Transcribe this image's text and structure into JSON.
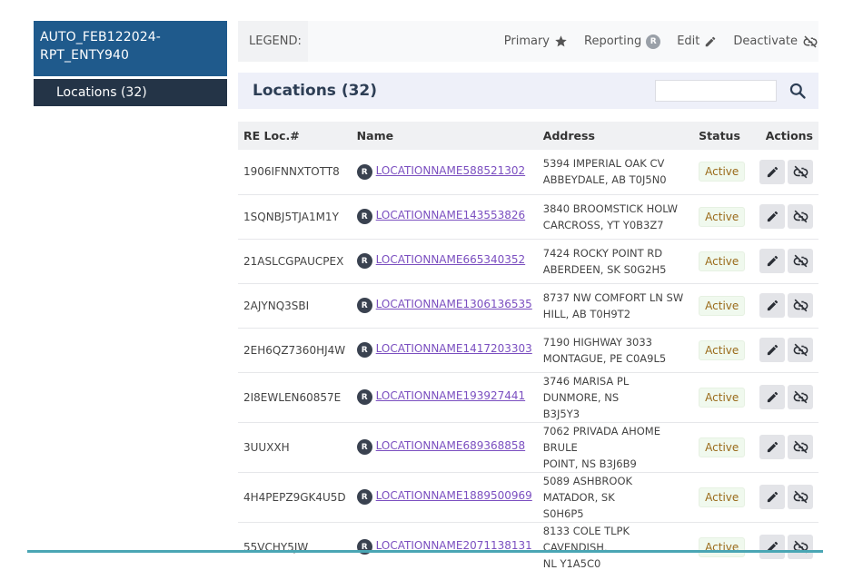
{
  "sidebar": {
    "entity_title": "AUTO_FEB122024-RPT_ENTY940",
    "items": [
      {
        "label": "Locations (32)"
      }
    ]
  },
  "legend": {
    "label": "LEGEND:",
    "items": [
      {
        "label": "Primary",
        "icon": "star-icon"
      },
      {
        "label": "Reporting",
        "icon": "reporting-badge-icon",
        "badge": "R"
      },
      {
        "label": "Edit",
        "icon": "pencil-icon"
      },
      {
        "label": "Deactivate",
        "icon": "unlink-icon"
      }
    ]
  },
  "panel": {
    "title": "Locations (32)",
    "search": {
      "value": "",
      "placeholder": ""
    }
  },
  "table": {
    "columns": [
      "RE Loc.#",
      "Name",
      "Address",
      "Status",
      "Actions"
    ],
    "rows": [
      {
        "loc": "1906IFNNXTOTT8",
        "badge": "R",
        "name": "LOCATIONNAME588521302",
        "addr1": "5394 IMPERIAL OAK CV",
        "addr2": "ABBEYDALE, AB T0J5N0",
        "status": "Active"
      },
      {
        "loc": "1SQNBJ5TJA1M1Y",
        "badge": "R",
        "name": "LOCATIONNAME143553826",
        "addr1": "3840 BROOMSTICK HOLW",
        "addr2": "CARCROSS, YT Y0B3Z7",
        "status": "Active"
      },
      {
        "loc": "21ASLCGPAUCPEX",
        "badge": "R",
        "name": "LOCATIONNAME665340352",
        "addr1": "7424 ROCKY POINT RD",
        "addr2": "ABERDEEN, SK S0G2H5",
        "status": "Active"
      },
      {
        "loc": "2AJYNQ3SBI",
        "badge": "R",
        "name": "LOCATIONNAME1306136535",
        "addr1": "8737 NW COMFORT LN SW",
        "addr2": "HILL, AB T0H9T2",
        "status": "Active"
      },
      {
        "loc": "2EH6QZ7360HJ4W",
        "badge": "R",
        "name": "LOCATIONNAME1417203303",
        "addr1": "7190 HIGHWAY 3033",
        "addr2": "MONTAGUE, PE C0A9L5",
        "status": "Active"
      },
      {
        "loc": "2I8EWLEN60857E",
        "badge": "R",
        "name": "LOCATIONNAME193927441",
        "addr1": "3746 MARISA PL DUNMORE, NS",
        "addr2": "B3J5Y3",
        "status": "Active"
      },
      {
        "loc": "3UUXXH",
        "badge": "R",
        "name": "LOCATIONNAME689368858",
        "addr1": "7062 PRIVADA AHOME BRULE",
        "addr2": "POINT, NS B3J6B9",
        "status": "Active"
      },
      {
        "loc": "4H4PEPZ9GK4U5D",
        "badge": "R",
        "name": "LOCATIONNAME1889500969",
        "addr1": "5089 ASHBROOK MATADOR, SK",
        "addr2": "S0H6P5",
        "status": "Active"
      },
      {
        "loc": "55VCHY5JW",
        "badge": "R",
        "name": "LOCATIONNAME2071138131",
        "addr1": "8133 COLE TLPK CAVENDISH,",
        "addr2": "NL Y1A5C0",
        "status": "Active"
      }
    ]
  },
  "colors": {
    "entity_header": "#1f5a8c",
    "sidebar_item": "#243447",
    "link": "#7b4fc0",
    "status_text": "#9a6a1a",
    "bottom_rule": "#4aa6b4"
  }
}
